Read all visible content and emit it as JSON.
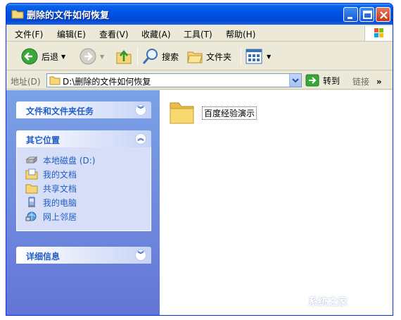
{
  "window": {
    "title": "删除的文件如何恢复"
  },
  "menu": [
    "文件(F)",
    "编辑(E)",
    "查看(V)",
    "收藏(A)",
    "工具(T)",
    "帮助(H)"
  ],
  "toolbar": {
    "back_label": "后退",
    "search_label": "搜索",
    "folders_label": "文件夹"
  },
  "address": {
    "label": "地址(D)",
    "value": "D:\\删除的文件如何恢复",
    "go_label": "转到",
    "links_label": "链接"
  },
  "taskpane": {
    "panels": [
      {
        "title": "文件和文件夹任务",
        "collapsed": true
      },
      {
        "title": "其它位置",
        "collapsed": false,
        "items": [
          {
            "label": "本地磁盘 (D:)",
            "icon": "drive-icon"
          },
          {
            "label": "我的文档",
            "icon": "my-documents-icon"
          },
          {
            "label": "共享文档",
            "icon": "shared-folder-icon"
          },
          {
            "label": "我的电脑",
            "icon": "my-computer-icon"
          },
          {
            "label": "网上邻居",
            "icon": "network-places-icon"
          }
        ]
      },
      {
        "title": "详细信息",
        "collapsed": true
      }
    ]
  },
  "content": {
    "items": [
      {
        "name": "百度经验演示",
        "icon": "folder-icon"
      }
    ]
  },
  "watermark": "系统之家",
  "colors": {
    "titlebar": "#0054e3",
    "taskpane": "#6d8ddf",
    "panel_title": "#215dc6"
  }
}
